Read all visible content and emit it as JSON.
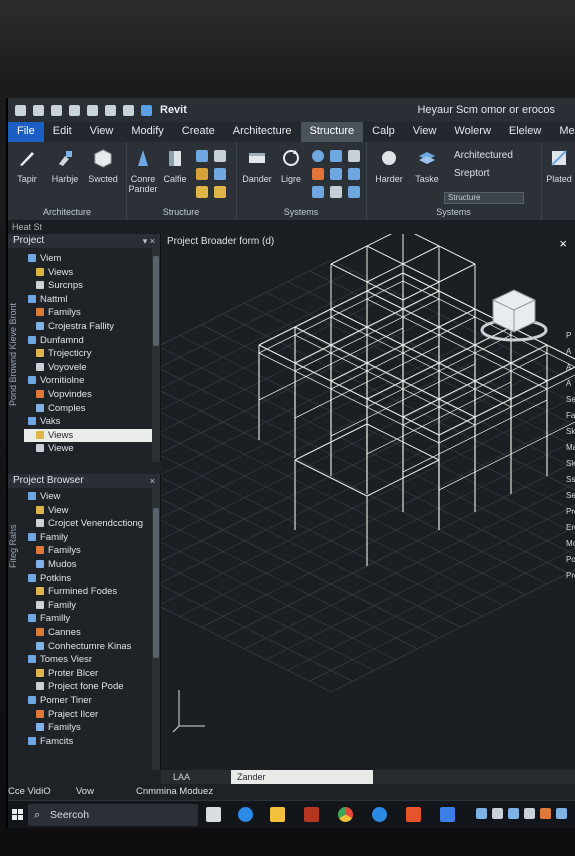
{
  "quick_access": {
    "app": "Revit",
    "title": "Heyaur Scm omor or erocos"
  },
  "tabs": [
    "File",
    "Edit",
    "View",
    "Modify",
    "Create",
    "Architecture",
    "Structure",
    "Calp",
    "View",
    "Wolerw",
    "Elelew",
    "Melr"
  ],
  "ribbon": {
    "architecture_tools": [
      "Tapir",
      "Harbje",
      "Swcted"
    ],
    "architecture_label": "Architecture",
    "structure_tools": [
      "Conre Pander",
      "Calfie"
    ],
    "structure_label": "Structure",
    "systems_tools": [
      "Dander",
      "Ligre"
    ],
    "systems_label": "Systems",
    "systems2_tools": [
      "Harder",
      "Taske"
    ],
    "systems2_side": [
      "Architectured",
      "Sreptort"
    ],
    "systems2_dropdown": "Structure",
    "systems2_label": "Systems",
    "far_right_tool": "Plated"
  },
  "selbar": "Heat St",
  "project_panel": {
    "title": "Project",
    "side_labels": "Pond Brownd  Kieve Bront",
    "items": [
      "Viem",
      "Views",
      "Surcnps",
      "Nattml",
      "Familys",
      "Crojestra Fallity",
      "Dunfamnd",
      "Trojecticry",
      "Voyovele",
      "Vornitiolne",
      "Vopvindes",
      "Comples",
      "Vaks",
      "Views",
      "Viewe"
    ],
    "selected_index": 13
  },
  "browser_panel": {
    "title": "Project Browser",
    "side_labels": "Fiteg Rahs",
    "items": [
      "View",
      "View",
      "Crojcet Venendcctiong",
      "Family",
      "Familys",
      "Mudos",
      "Potkins",
      "Furmined Fodes",
      "Family",
      "Familly",
      "Cannes",
      "Conhectumre Kinas",
      "Tomes Viesr",
      "Proter Blcer",
      "Project fone Pode",
      "Pomer Tiner",
      "Praject Ilcer",
      "Familys",
      "Famcits"
    ]
  },
  "viewport": {
    "title": "Project Broader form (d)",
    "close": "×",
    "right_strip": [
      "P",
      "A",
      "A",
      "A",
      "",
      "Se",
      "Fa",
      "Sk",
      "Ma",
      "Sle",
      "Ssi",
      "Sele",
      "Prd",
      "Eru",
      "Mo",
      "Pon",
      "Proc"
    ]
  },
  "view_tabs": [
    "LAA",
    "Zander"
  ],
  "status": {
    "left": "Cce VidiO",
    "mid1": "Vow",
    "mid2": "Cnmmina Moduez"
  },
  "taskbar": {
    "search": "Seercoh"
  },
  "colors": {
    "accent": "#1c5ec3",
    "wire": "#e8efe8",
    "grid": "#3a4148"
  }
}
